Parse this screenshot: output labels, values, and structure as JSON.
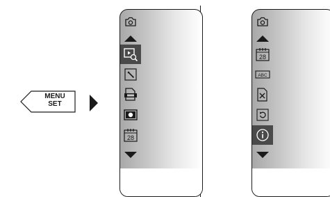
{
  "menu_key": {
    "line1": "MENU",
    "line2": "SET"
  },
  "screens": [
    {
      "items": [
        "image-zoom-icon",
        "tool-icon",
        "document-icon",
        "camera-screen-icon",
        "calendar-icon"
      ],
      "selected_index": 0,
      "calendar_number": "28"
    },
    {
      "items": [
        "calendar-icon",
        "abc-text-icon",
        "delete-file-icon",
        "rotate-icon",
        "info-icon"
      ],
      "selected_index": 4,
      "calendar_number": "28",
      "abc_text": "ABC"
    }
  ],
  "colors": {
    "selected": "#4a4a4a",
    "icon_stroke": "#1a1a1a",
    "selected_icon_stroke": "#ffffff"
  }
}
